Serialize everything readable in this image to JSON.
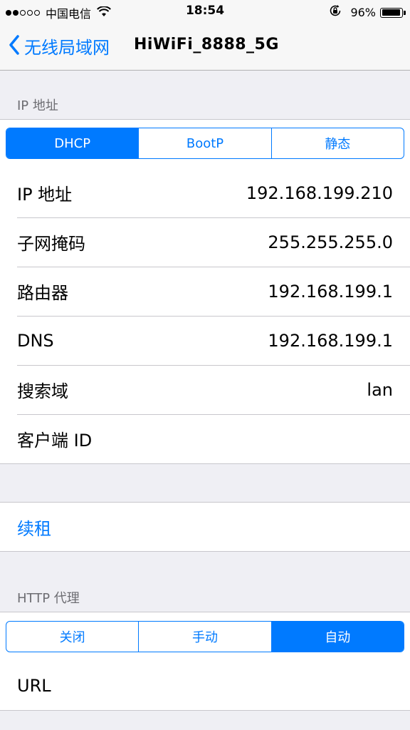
{
  "status_bar": {
    "carrier": "中国电信",
    "time": "18:54",
    "battery_percent": "96%",
    "battery_level": 0.96,
    "signal_bars_filled": 2,
    "signal_bars_total": 5
  },
  "nav": {
    "back_label": "无线局域网",
    "title": "HiWiFi_8888_5G"
  },
  "ip_section": {
    "header": "IP 地址",
    "segments": [
      {
        "label": "DHCP",
        "selected": true
      },
      {
        "label": "BootP",
        "selected": false
      },
      {
        "label": "静态",
        "selected": false
      }
    ],
    "rows": [
      {
        "label": "IP 地址",
        "value": "192.168.199.210"
      },
      {
        "label": "子网掩码",
        "value": "255.255.255.0"
      },
      {
        "label": "路由器",
        "value": "192.168.199.1"
      },
      {
        "label": "DNS",
        "value": "192.168.199.1"
      },
      {
        "label": "搜索域",
        "value": "lan"
      },
      {
        "label": "客户端 ID",
        "value": ""
      }
    ]
  },
  "renew": {
    "label": "续租"
  },
  "proxy_section": {
    "header": "HTTP 代理",
    "segments": [
      {
        "label": "关闭",
        "selected": false
      },
      {
        "label": "手动",
        "selected": false
      },
      {
        "label": "自动",
        "selected": true
      }
    ],
    "url_label": "URL"
  },
  "colors": {
    "accent": "#007aff",
    "background": "#efeff4",
    "separator": "#c8c7cc",
    "section_text": "#6d6d72"
  }
}
